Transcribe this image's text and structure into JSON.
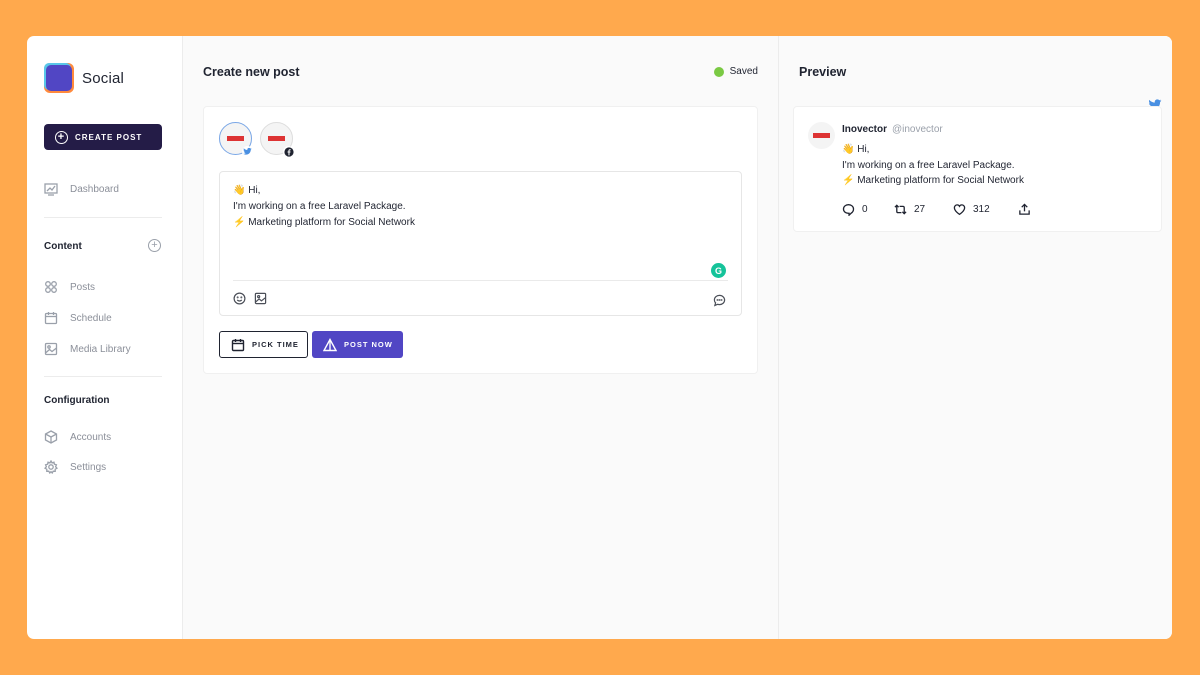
{
  "app": {
    "name": "Social"
  },
  "sidebar": {
    "create_post_label": "CREATE POST",
    "dashboard_label": "Dashboard",
    "content_title": "Content",
    "content_items": [
      {
        "label": "Posts",
        "icon": "grid-icon"
      },
      {
        "label": "Schedule",
        "icon": "calendar-icon"
      },
      {
        "label": "Media Library",
        "icon": "image-icon"
      }
    ],
    "configuration_title": "Configuration",
    "configuration_items": [
      {
        "label": "Accounts",
        "icon": "cube-icon"
      },
      {
        "label": "Settings",
        "icon": "gear-icon"
      }
    ]
  },
  "editor": {
    "title": "Create new post",
    "status": "Saved",
    "status_color": "#7ac943",
    "accounts": [
      {
        "name": "inovector",
        "network": "twitter"
      },
      {
        "name": "inovector",
        "network": "facebook"
      }
    ],
    "lines": [
      "👋 Hi,",
      "I'm working on a free Laravel Package.",
      "⚡ Marketing platform for Social Network"
    ],
    "pick_time_label": "PICK TIME",
    "post_now_label": "POST NOW"
  },
  "preview": {
    "title": "Preview",
    "tweet": {
      "name": "Inovector",
      "handle": "@inovector",
      "lines": [
        "👋 Hi,",
        "I'm working on a free Laravel Package.",
        "⚡ Marketing platform for Social Network"
      ],
      "replies": "0",
      "retweets": "27",
      "likes": "312"
    }
  },
  "colors": {
    "background": "#FFA94D",
    "primary": "#5146c4",
    "dark": "#241c47"
  }
}
